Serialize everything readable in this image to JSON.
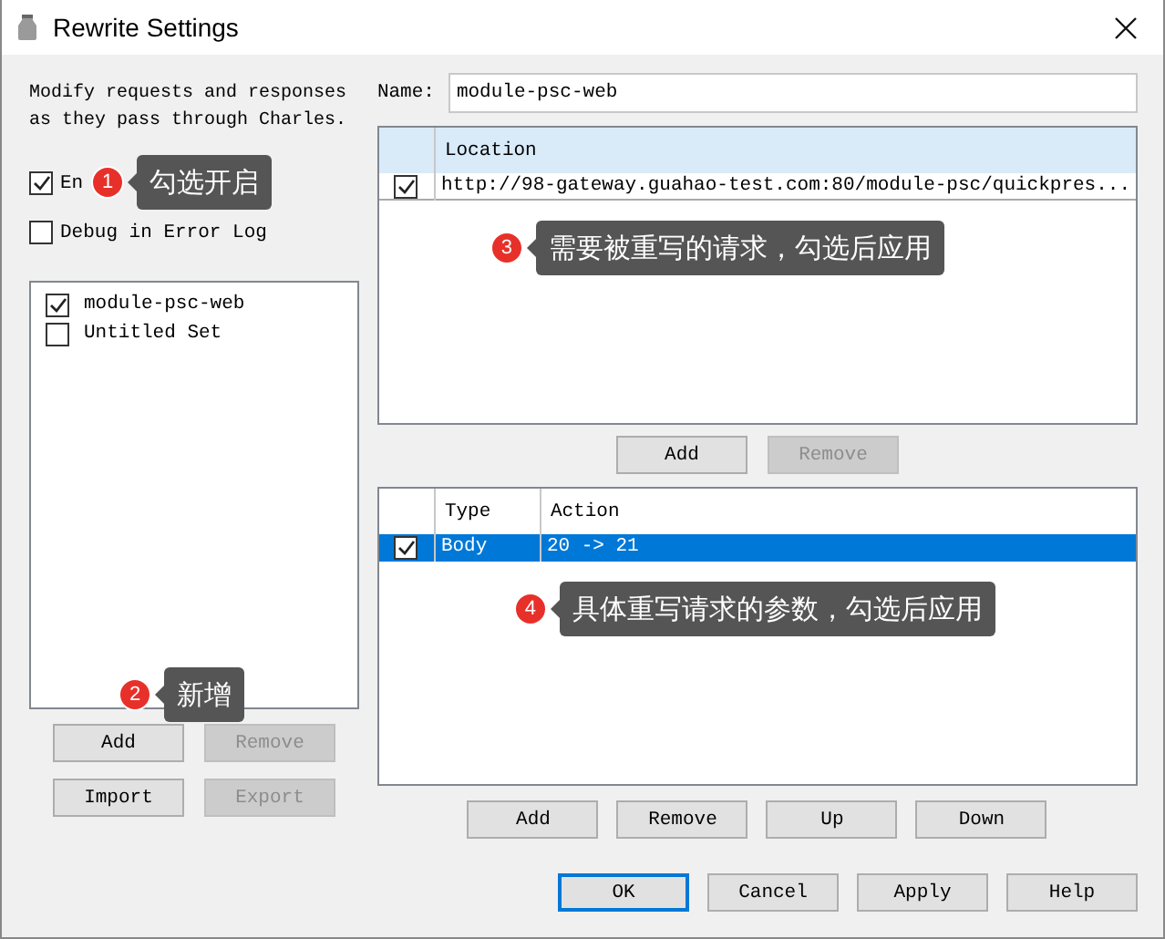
{
  "window": {
    "title": "Rewrite Settings"
  },
  "description": "Modify requests and responses as they pass through Charles.",
  "options": [
    {
      "label": "En",
      "checked": true
    },
    {
      "label": "Debug in Error Log",
      "checked": false
    }
  ],
  "sets": [
    {
      "label": "module-psc-web",
      "checked": true
    },
    {
      "label": "Untitled Set",
      "checked": false
    }
  ],
  "set_buttons": [
    {
      "label": "Add",
      "disabled": false
    },
    {
      "label": "Remove",
      "disabled": true
    },
    {
      "label": "Import",
      "disabled": false
    },
    {
      "label": "Export",
      "disabled": true
    }
  ],
  "name": {
    "label": "Name:",
    "value": "module-psc-web"
  },
  "locations": {
    "columns": [
      "Location"
    ],
    "rows": [
      {
        "checked": true,
        "selected": false,
        "cells": [
          "http://98-gateway.guahao-test.com:80/module-psc/quickpres..."
        ]
      }
    ]
  },
  "location_buttons": [
    {
      "label": "Add",
      "disabled": false
    },
    {
      "label": "Remove",
      "disabled": true
    }
  ],
  "rules": {
    "columns": [
      "Type",
      "Action"
    ],
    "rows": [
      {
        "checked": true,
        "selected": true,
        "cells": [
          "Body",
          "20 -> 21"
        ]
      }
    ]
  },
  "rule_buttons": [
    {
      "label": "Add",
      "disabled": false
    },
    {
      "label": "Remove",
      "disabled": false
    },
    {
      "label": "Up",
      "disabled": false
    },
    {
      "label": "Down",
      "disabled": false
    }
  ],
  "dialog_buttons": [
    {
      "label": "OK",
      "default": true
    },
    {
      "label": "Cancel",
      "default": false
    },
    {
      "label": "Apply",
      "default": false
    },
    {
      "label": "Help",
      "default": false
    }
  ],
  "annotations": [
    {
      "number": "1",
      "text": "勾选开启"
    },
    {
      "number": "2",
      "text": "新增"
    },
    {
      "number": "3",
      "text": "需要被重写的请求，勾选后应用"
    },
    {
      "number": "4",
      "text": "具体重写请求的参数，勾选后应用"
    }
  ]
}
